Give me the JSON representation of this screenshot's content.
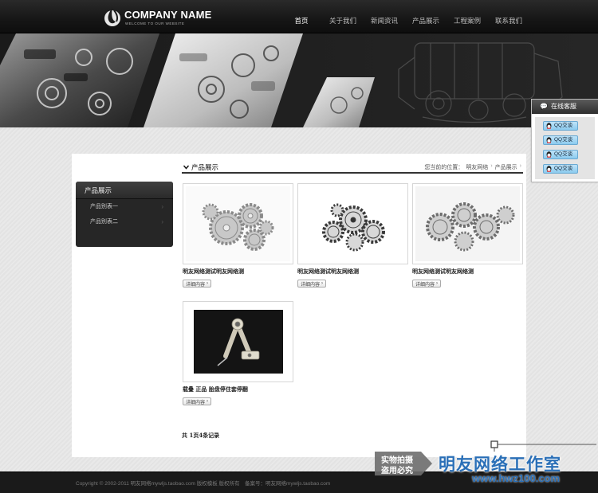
{
  "header": {
    "company_name": "COMPANY NAME",
    "tagline": "WELCOME TO OUR WEBSITE",
    "nav": [
      {
        "label": "首页",
        "active": true
      },
      {
        "label": "关于我们",
        "active": false
      },
      {
        "label": "新闻资讯",
        "active": false
      },
      {
        "label": "产品展示",
        "active": false
      },
      {
        "label": "工程案例",
        "active": false
      },
      {
        "label": "联系我们",
        "active": false
      }
    ]
  },
  "service": {
    "title": "在线客服",
    "buttons": [
      "QQ交谈",
      "QQ交谈",
      "QQ交谈",
      "QQ交谈"
    ]
  },
  "sidebar": {
    "title": "产品展示",
    "items": [
      {
        "label": "产品别表一"
      },
      {
        "label": "产品别表二"
      }
    ]
  },
  "content": {
    "title": "产品展示",
    "breadcrumb": {
      "prefix": "您当前的位置：",
      "items": [
        "明友网络",
        "产品展示"
      ]
    },
    "products": [
      {
        "title": "明友网络测试明友网络测",
        "button": "详细内容"
      },
      {
        "title": "明友网络测试明友网络测",
        "button": "详细内容"
      },
      {
        "title": "明友网络测试明友网络测",
        "button": "详细内容"
      },
      {
        "title": "载叠 正品 胎盘停住套停翻",
        "button": "详细内容"
      }
    ],
    "pager": {
      "prefix": "共 ",
      "pages": "1",
      "middle": "页",
      "count": "4",
      "suffix": "条记录"
    }
  },
  "footer": {
    "copyright": "Copyright © 2002-2011 明友网络mywljs.taobao.com 版权模板 版权所有　备案号：明友网络mywljs.taobao.com"
  },
  "watermark": {
    "left_line1": "实物拍摄",
    "left_line2": "盗用必究",
    "brand": "明友网络工作室",
    "url": "www.hwz100.com"
  },
  "colors": {
    "header_bg": "#161616",
    "accent_qq": "#8ccbef",
    "watermark_blue": "#2a6fb7"
  }
}
